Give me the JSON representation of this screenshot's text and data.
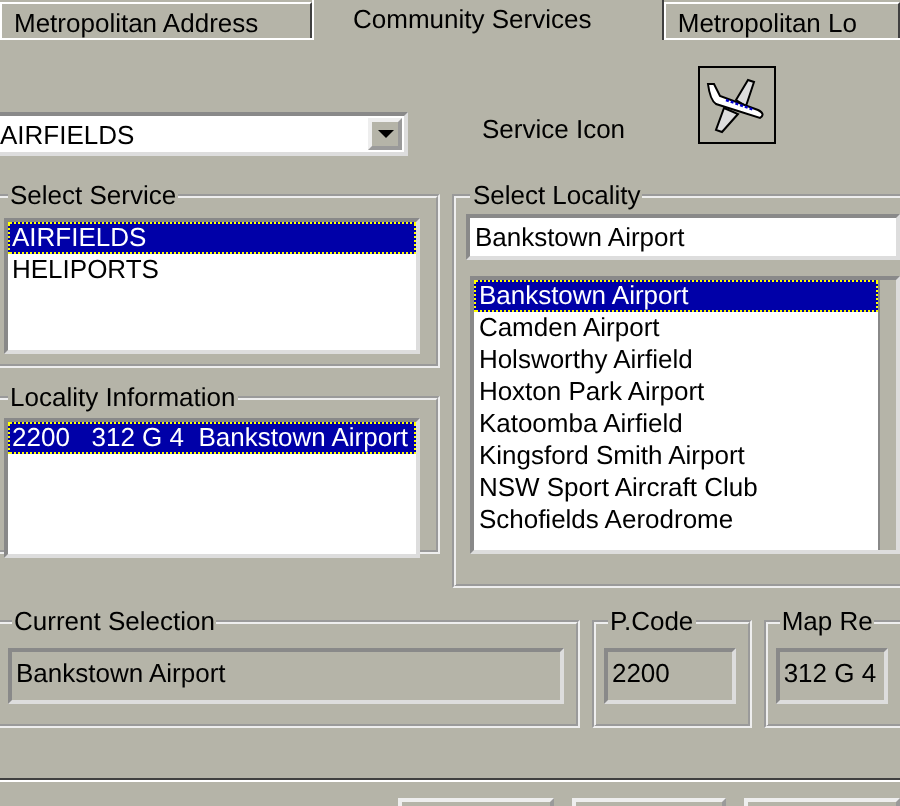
{
  "tabs": [
    {
      "label": "Metropolitan Address",
      "selected": false
    },
    {
      "label": "Community Services",
      "selected": true
    },
    {
      "label": "Metropolitan Lo",
      "selected": false
    }
  ],
  "service_dropdown": {
    "value": "AIRFIELDS"
  },
  "service_icon": {
    "label": "Service Icon"
  },
  "select_service": {
    "title": "Select Service",
    "items": [
      {
        "label": "AIRFIELDS",
        "selected": true
      },
      {
        "label": "HELIPORTS",
        "selected": false
      }
    ]
  },
  "locality_information": {
    "title": "Locality Information",
    "items": [
      {
        "label": "2200   312 G 4  Bankstown Airport",
        "selected": true
      }
    ]
  },
  "select_locality": {
    "title": "Select Locality",
    "search": {
      "value": "Bankstown Airport"
    },
    "items": [
      {
        "label": "Bankstown Airport",
        "selected": true
      },
      {
        "label": "Camden Airport",
        "selected": false
      },
      {
        "label": "Holsworthy Airfield",
        "selected": false
      },
      {
        "label": "Hoxton Park Airport",
        "selected": false
      },
      {
        "label": "Katoomba Airfield",
        "selected": false
      },
      {
        "label": "Kingsford Smith Airport",
        "selected": false
      },
      {
        "label": "NSW Sport Aircraft Club",
        "selected": false
      },
      {
        "label": "Schofields Aerodrome",
        "selected": false
      }
    ]
  },
  "current_selection": {
    "title": "Current Selection",
    "value": "Bankstown Airport"
  },
  "postcode": {
    "title": "P.Code",
    "value": "2200"
  },
  "map_reference": {
    "title": "Map Re",
    "value": "312 G 4"
  }
}
